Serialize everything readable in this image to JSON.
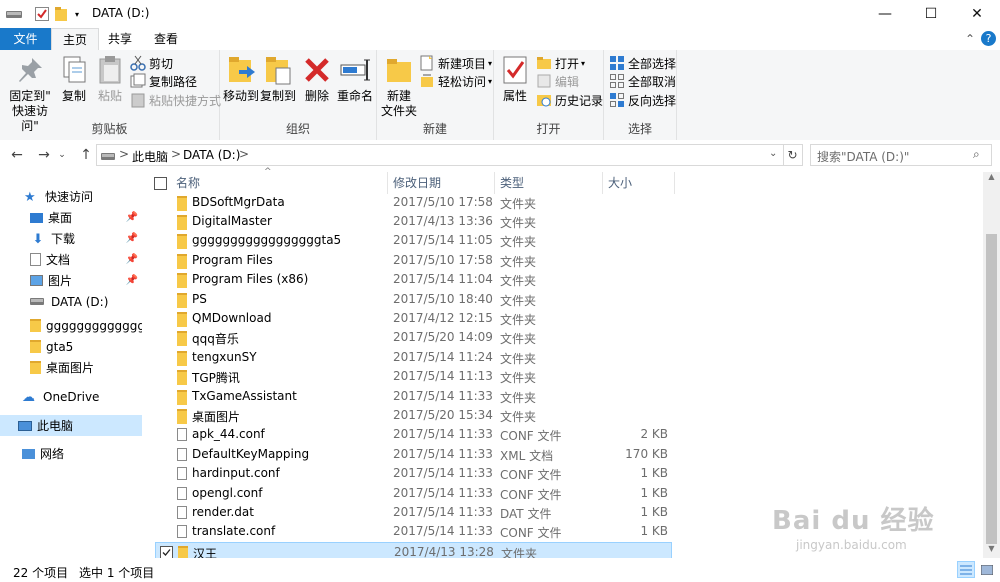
{
  "window": {
    "title": "DATA (D:)",
    "minimize_glyph": "—",
    "maximize_glyph": "☐",
    "close_glyph": "✕",
    "help_glyph": "?",
    "collapse_glyph": "⌃"
  },
  "ribbon_tabs": [
    "文件",
    "主页",
    "共享",
    "查看"
  ],
  "ribbon": {
    "clipboard": {
      "label": "剪贴板",
      "pin": "固定到\"\n快速访问\"",
      "copy": "复制",
      "paste": "粘贴",
      "cut": "剪切",
      "copy_path": "复制路径",
      "paste_shortcut": "粘贴快捷方式"
    },
    "organize": {
      "label": "组织",
      "move_to": "移动到",
      "copy_to": "复制到",
      "delete": "删除",
      "rename": "重命名"
    },
    "new": {
      "label": "新建",
      "new_folder": "新建\n文件夹",
      "new_item": "新建项目",
      "easy_access": "轻松访问"
    },
    "open": {
      "label": "打开",
      "properties": "属性",
      "open": "打开",
      "edit": "编辑",
      "history": "历史记录"
    },
    "select": {
      "label": "选择",
      "select_all": "全部选择",
      "select_none": "全部取消",
      "invert": "反向选择"
    }
  },
  "address": {
    "breadcrumb": [
      "此电脑",
      "DATA (D:)"
    ],
    "separator": ">",
    "search_placeholder": "搜索\"DATA (D:)\""
  },
  "nav_pane": {
    "quick_access": "快速访问",
    "items": [
      {
        "label": "桌面",
        "pinned": true
      },
      {
        "label": "下载",
        "pinned": true
      },
      {
        "label": "文档",
        "pinned": true
      },
      {
        "label": "图片",
        "pinned": true
      },
      {
        "label": "DATA (D:)",
        "pinned": false
      },
      {
        "label": "gggggggggggggg",
        "pinned": false
      },
      {
        "label": "gta5",
        "pinned": false
      },
      {
        "label": "桌面图片",
        "pinned": false
      }
    ],
    "onedrive": "OneDrive",
    "this_pc": "此电脑",
    "network": "网络"
  },
  "columns": [
    "名称",
    "修改日期",
    "类型",
    "大小"
  ],
  "files": [
    {
      "name": "BDSoftMgrData",
      "date": "2017/5/10 17:58",
      "type": "文件夹",
      "size": "",
      "kind": "folder"
    },
    {
      "name": "DigitalMaster",
      "date": "2017/4/13 13:36",
      "type": "文件夹",
      "size": "",
      "kind": "folder"
    },
    {
      "name": "gggggggggggggggggta5",
      "date": "2017/5/14 11:05",
      "type": "文件夹",
      "size": "",
      "kind": "folder"
    },
    {
      "name": "Program Files",
      "date": "2017/5/10 17:58",
      "type": "文件夹",
      "size": "",
      "kind": "folder"
    },
    {
      "name": "Program Files (x86)",
      "date": "2017/5/14 11:04",
      "type": "文件夹",
      "size": "",
      "kind": "folder"
    },
    {
      "name": "PS",
      "date": "2017/5/10 18:40",
      "type": "文件夹",
      "size": "",
      "kind": "folder"
    },
    {
      "name": "QMDownload",
      "date": "2017/4/12 12:15",
      "type": "文件夹",
      "size": "",
      "kind": "folder"
    },
    {
      "name": "qqq音乐",
      "date": "2017/5/20 14:09",
      "type": "文件夹",
      "size": "",
      "kind": "folder"
    },
    {
      "name": "tengxunSY",
      "date": "2017/5/14 11:24",
      "type": "文件夹",
      "size": "",
      "kind": "folder"
    },
    {
      "name": "TGP腾讯",
      "date": "2017/5/14 11:13",
      "type": "文件夹",
      "size": "",
      "kind": "folder"
    },
    {
      "name": "TxGameAssistant",
      "date": "2017/5/14 11:33",
      "type": "文件夹",
      "size": "",
      "kind": "folder"
    },
    {
      "name": "桌面图片",
      "date": "2017/5/20 15:34",
      "type": "文件夹",
      "size": "",
      "kind": "folder"
    },
    {
      "name": "apk_44.conf",
      "date": "2017/5/14 11:33",
      "type": "CONF 文件",
      "size": "2 KB",
      "kind": "file"
    },
    {
      "name": "DefaultKeyMapping",
      "date": "2017/5/14 11:33",
      "type": "XML 文档",
      "size": "170 KB",
      "kind": "file"
    },
    {
      "name": "hardinput.conf",
      "date": "2017/5/14 11:33",
      "type": "CONF 文件",
      "size": "1 KB",
      "kind": "file"
    },
    {
      "name": "opengl.conf",
      "date": "2017/5/14 11:33",
      "type": "CONF 文件",
      "size": "1 KB",
      "kind": "file"
    },
    {
      "name": "render.dat",
      "date": "2017/5/14 11:33",
      "type": "DAT 文件",
      "size": "1 KB",
      "kind": "file"
    },
    {
      "name": "translate.conf",
      "date": "2017/5/14 11:33",
      "type": "CONF 文件",
      "size": "1 KB",
      "kind": "file"
    },
    {
      "name": "汉王",
      "date": "2017/4/13 13:28",
      "type": "文件夹",
      "size": "",
      "kind": "folder",
      "selected": true
    }
  ],
  "status": {
    "count": "22 个项目",
    "selection": "选中 1 个项目"
  },
  "watermark": {
    "brand": "Bai du 经验",
    "url": "jingyan.baidu.com"
  },
  "colors": {
    "accent": "#1979ca",
    "selection": "#cce8ff",
    "folder": "#f7c948"
  }
}
